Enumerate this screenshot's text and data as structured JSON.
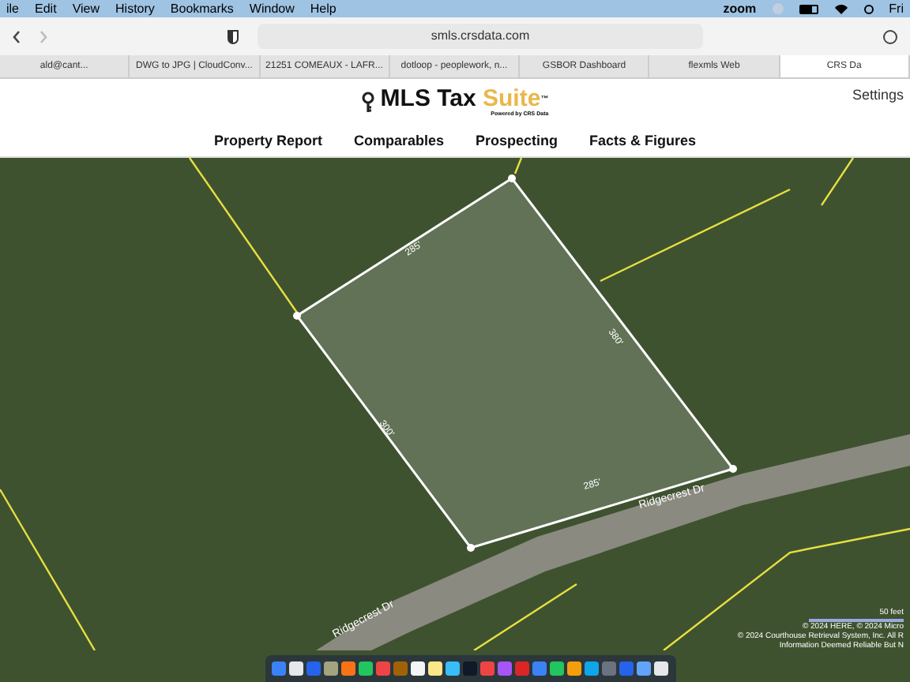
{
  "menu_bar": {
    "items": [
      "ile",
      "Edit",
      "View",
      "History",
      "Bookmarks",
      "Window",
      "Help"
    ],
    "app_label": "zoom",
    "clock": "Fri"
  },
  "toolbar": {
    "address": "smls.crsdata.com"
  },
  "tabs": [
    {
      "label": "ald@cant...",
      "selected": false
    },
    {
      "label": "DWG to JPG | CloudConv...",
      "selected": false
    },
    {
      "label": "21251 COMEAUX - LAFR...",
      "selected": false
    },
    {
      "label": "dotloop - peoplework, n...",
      "selected": false
    },
    {
      "label": "GSBOR Dashboard",
      "selected": false
    },
    {
      "label": "flexmls Web",
      "selected": false
    },
    {
      "label": "CRS Da",
      "selected": true
    }
  ],
  "header": {
    "logo_main": "MLS Tax ",
    "logo_accent": "Suite",
    "logo_tm": "™",
    "logo_sub": "Powered by CRS Data",
    "settings": "Settings"
  },
  "nav": [
    "Property Report",
    "Comparables",
    "Prospecting",
    "Facts & Figures"
  ],
  "map": {
    "parcel_edges": [
      "285'",
      "380'",
      "300'",
      "285'"
    ],
    "street_labels": [
      "Ridgecrest Dr",
      "Ridgecrest Dr"
    ],
    "scale": "50 feet",
    "attribution": [
      "© 2024 HERE, © 2024 Micro",
      "© 2024 Courthouse Retrieval System, Inc. All R",
      "Information Deemed Reliable But N"
    ]
  }
}
